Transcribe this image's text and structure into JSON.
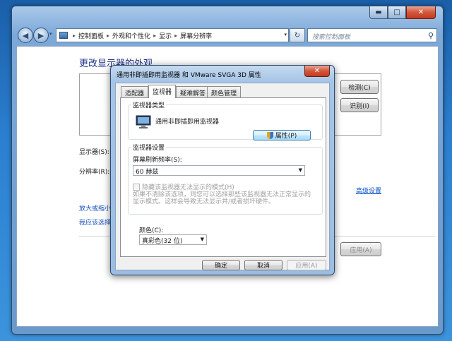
{
  "explorer": {
    "window_buttons": {
      "minimize": "▬",
      "maximize": "□",
      "close": "✕"
    },
    "nav": {
      "back_glyph": "◀",
      "forward_glyph": "▶",
      "dropdown_glyph": "▾"
    },
    "address": {
      "crumbs": [
        "控制面板",
        "外观和个性化",
        "显示",
        "屏幕分辨率"
      ],
      "separator": "▸",
      "dropdown_glyph": "▾"
    },
    "refresh_glyph": "↻",
    "search": {
      "placeholder": "搜索控制面板",
      "icon": "search-icon",
      "glyph": "⚲"
    }
  },
  "control_panel": {
    "title": "更改显示器的外观",
    "detect_button": "检测(C)",
    "identify_button": "识别(I)",
    "display_label": "显示器(S):",
    "resolution_label": "分辨率(R):",
    "advanced_link": "高级设置",
    "link_enlarge": "放大或缩小",
    "link_which": "我应该选择",
    "apply_button": "应用(A)"
  },
  "dialog": {
    "title": "通用非即插即用监视器 和 VMware SVGA 3D 属性",
    "close_glyph": "✕",
    "tabs": [
      "适配器",
      "监视器",
      "疑难解答",
      "颜色管理"
    ],
    "active_tab": "监视器",
    "monitor_type_group": "监视器类型",
    "monitor_name": "通用非即插即用监视器",
    "properties_button": "属性(P)",
    "monitor_settings_group": "监视器设置",
    "refresh_rate_label": "屏幕刷新频率(S):",
    "refresh_rate_value": "60 赫兹",
    "hide_modes_checkbox": "隐藏该监视器无法显示的模式(H)",
    "hide_modes_checked": false,
    "description_line1": "如果不清除该选项，则您可以选择那些该监视器无法正常显示的",
    "description_line2": "显示模式。这样会导致无法显示并/或者损坏硬件。",
    "color_label": "颜色(C):",
    "color_value": "真彩色(32 位)",
    "ok_button": "确定",
    "cancel_button": "取消",
    "apply_button": "应用(A)",
    "dropdown_glyph": "▼"
  },
  "colors": {
    "link": "#1652b9",
    "title_blue": "#1e3287",
    "close_red": "#c23c21"
  }
}
